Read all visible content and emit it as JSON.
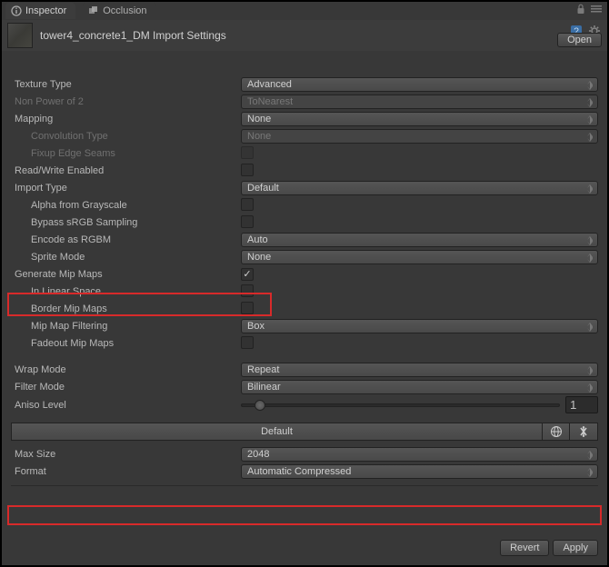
{
  "tabs": {
    "inspector": "Inspector",
    "occlusion": "Occlusion"
  },
  "header": {
    "title": "tower4_concrete1_DM Import Settings",
    "open": "Open"
  },
  "props": {
    "texture_type": {
      "label": "Texture Type",
      "value": "Advanced"
    },
    "npot": {
      "label": "Non Power of 2",
      "value": "ToNearest"
    },
    "mapping": {
      "label": "Mapping",
      "value": "None"
    },
    "conv_type": {
      "label": "Convolution Type",
      "value": "None"
    },
    "fixup": {
      "label": "Fixup Edge Seams"
    },
    "read_write": {
      "label": "Read/Write Enabled"
    },
    "import_type": {
      "label": "Import Type",
      "value": "Default"
    },
    "alpha_gs": {
      "label": "Alpha from Grayscale"
    },
    "bypass_srgb": {
      "label": "Bypass sRGB Sampling"
    },
    "encode_rgbm": {
      "label": "Encode as RGBM",
      "value": "Auto"
    },
    "sprite_mode": {
      "label": "Sprite Mode",
      "value": "None"
    },
    "gen_mip": {
      "label": "Generate Mip Maps"
    },
    "linear": {
      "label": "In Linear Space"
    },
    "border_mip": {
      "label": "Border Mip Maps"
    },
    "mip_filter": {
      "label": "Mip Map Filtering",
      "value": "Box"
    },
    "fadeout": {
      "label": "Fadeout Mip Maps"
    },
    "wrap": {
      "label": "Wrap Mode",
      "value": "Repeat"
    },
    "filter": {
      "label": "Filter Mode",
      "value": "Bilinear"
    },
    "aniso": {
      "label": "Aniso Level",
      "value": "1"
    },
    "platform_default": "Default",
    "max_size": {
      "label": "Max Size",
      "value": "2048"
    },
    "format": {
      "label": "Format",
      "value": "Automatic Compressed"
    }
  },
  "footer": {
    "revert": "Revert",
    "apply": "Apply"
  }
}
